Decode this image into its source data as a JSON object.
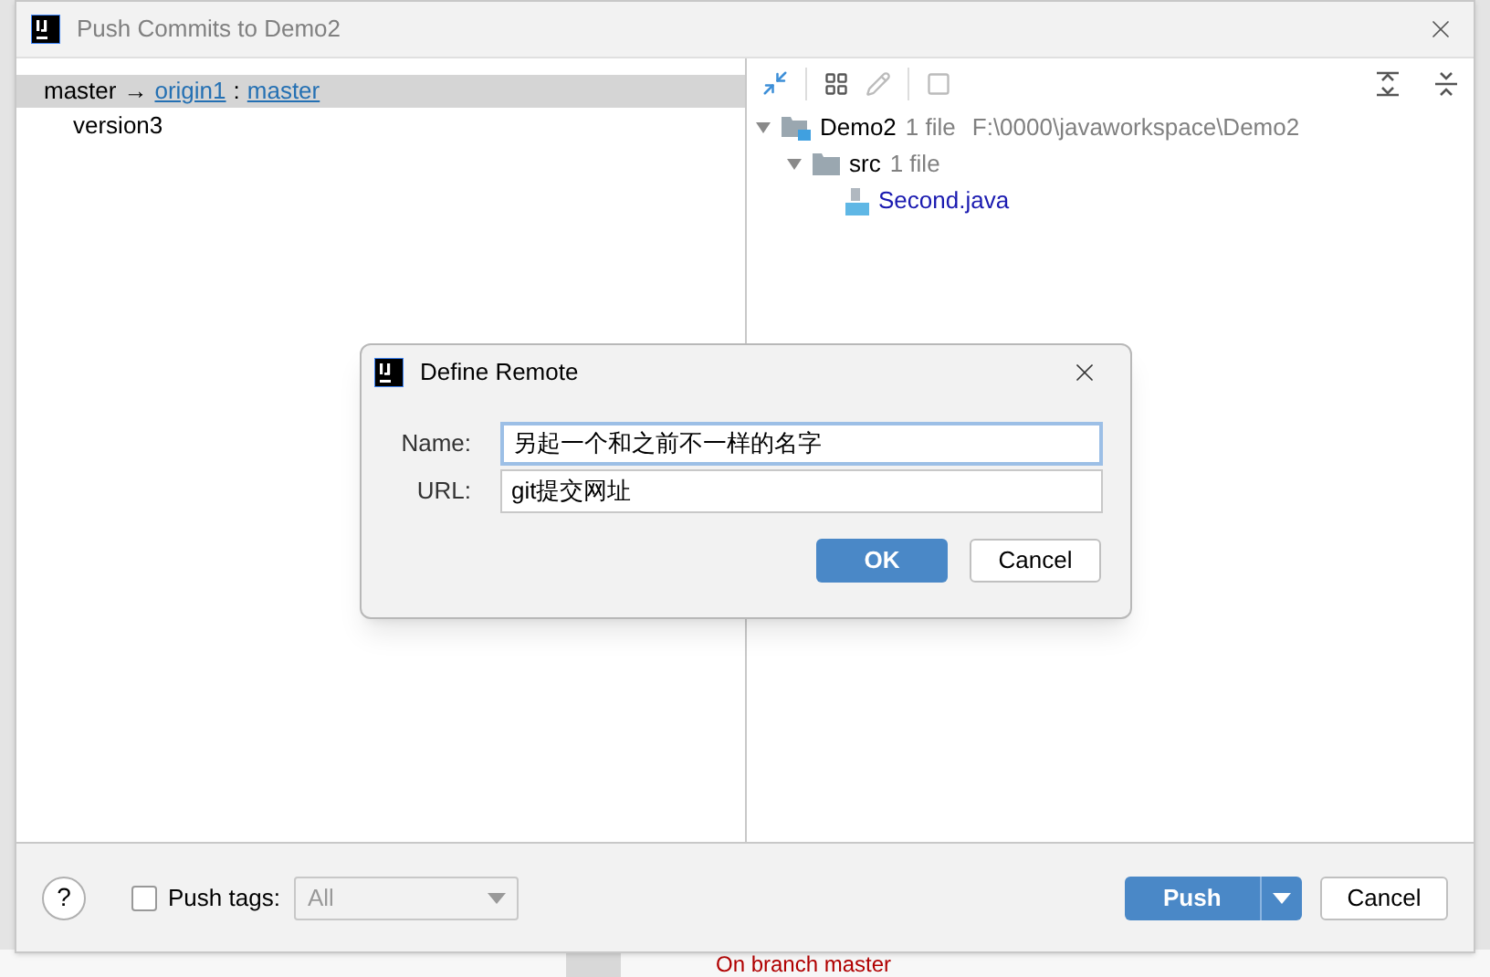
{
  "window": {
    "title": "Push Commits to Demo2"
  },
  "branches": [
    {
      "source": "master",
      "arrow": "→",
      "remote": "origin1",
      "separator": ":",
      "target": "master",
      "selected": true,
      "commits": [
        "version3"
      ]
    }
  ],
  "tree": [
    {
      "kind": "module",
      "name": "Demo2",
      "count": "1 file",
      "path": "F:\\0000\\javaworkspace\\Demo2",
      "expanded": true,
      "children": [
        {
          "kind": "folder",
          "name": "src",
          "count": "1 file",
          "expanded": true,
          "children": [
            {
              "kind": "file",
              "name": "Second.java"
            }
          ]
        }
      ]
    }
  ],
  "footer": {
    "help_button": "?",
    "push_tags": {
      "label": "Push tags:",
      "checked": false
    },
    "tags_select": {
      "value": "All",
      "disabled": true
    },
    "push_button": "Push",
    "cancel_button": "Cancel"
  },
  "dialog": {
    "title": "Define Remote",
    "fields": [
      {
        "label": "Name:",
        "value": "另起一个和之前不一样的名字",
        "focused": true
      },
      {
        "label": "URL:",
        "value": "git提交网址",
        "focused": false
      }
    ],
    "ok_button": "OK",
    "cancel_button": "Cancel"
  },
  "background": {
    "status_text": "On branch master"
  }
}
